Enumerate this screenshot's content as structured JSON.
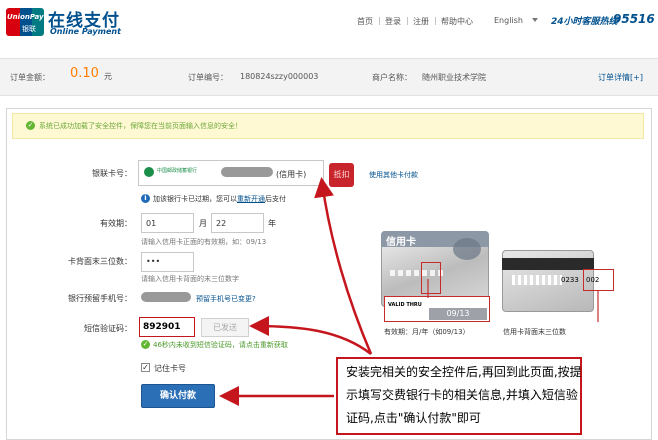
{
  "header": {
    "logo_top": "UnionPay",
    "logo_bottom": "银联",
    "brand_cn": "在线支付",
    "brand_en": "Online Payment",
    "nav": [
      "首页",
      "登录",
      "注册",
      "帮助中心"
    ],
    "lang": "English",
    "hotline_label": "24小时客服热线",
    "hotline_number": "95516"
  },
  "order": {
    "amount_label": "订单金额：",
    "amount": "0.10",
    "currency": "元",
    "number_label": "订单编号：",
    "number": "180824szzy000003",
    "merchant_label": "商户名称：",
    "merchant": "随州职业技术学院",
    "details_link": "订单详情[+]"
  },
  "notice": "系统已成功加载了安全控件，保障您在当前页面输入信息的安全！",
  "form": {
    "card_label": "银联卡号：",
    "bank_name": "中国邮政储蓄银行",
    "card_type": "(信用卡)",
    "tag_label": "抵扣",
    "other_card_link": "使用其他卡付款",
    "expired_msg_a": "加该银行卡已过期，您可以",
    "expired_msg_link": "重新开通",
    "expired_msg_b": "后支付",
    "expiry_label": "有效期：",
    "expiry_month": "01",
    "month_unit": "月",
    "expiry_year": "22",
    "year_unit": "年",
    "expiry_hint": "请输入信用卡正面的有效期，如：09/13",
    "cvv_label": "卡背面末三位数：",
    "cvv_value": "•••",
    "cvv_hint": "请输入信用卡背面的末三位数字",
    "phone_label": "银行预留手机号：",
    "phone_link": "预留手机号已变更?",
    "sms_label": "短信验证码：",
    "sms_value": "892901",
    "sms_button": "已发送",
    "sms_hint": "46秒内未收到短信验证码，请点击重新获取",
    "remember": "记住卡号",
    "pay_button": "确认付款"
  },
  "illustration": {
    "card_title": "信用卡",
    "valid_thru": "VALID THRU",
    "valid_date": "09/13",
    "front_caption": "有效期：月/年（如09/13）",
    "back_caption": "信用卡背面末三位数",
    "back_code_a": "0233",
    "back_code_b": "002"
  },
  "callout": "安装完相关的安全控件后,再回到此页面,按提示填写交费银行卡的相关信息,并填入短信验证码,点击\"确认付款\"即可",
  "colors": {
    "accent": "#00508e",
    "amount": "#ff7e00",
    "annotation": "#c5161d",
    "success": "#63b632"
  }
}
